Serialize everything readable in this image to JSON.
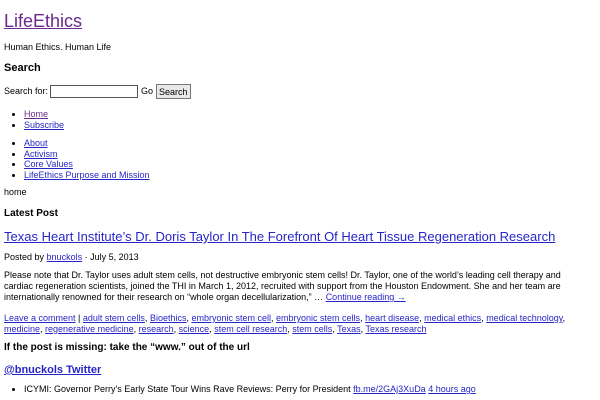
{
  "site": {
    "title": "LifeEthics",
    "tagline": "Human Ethics. Human Life"
  },
  "search": {
    "heading": "Search",
    "label": "Search for:",
    "value": "",
    "placeholder": "",
    "go": "Go",
    "button": "Search"
  },
  "menu_primary": [
    "Home",
    "Subscribe"
  ],
  "menu_secondary": [
    "About",
    "Activism",
    "Core Values",
    "LifeEthics Purpose and Mission"
  ],
  "breadcrumb": "home",
  "latest": {
    "heading": "Latest Post",
    "title": "Texas Heart Institute’s Dr. Doris Taylor In The Forefront Of Heart Tissue Regeneration Research",
    "posted_by": "Posted by",
    "author": "bnuckols",
    "separator": "·",
    "date": "July 5, 2013",
    "excerpt": "Please note that Dr. Taylor uses adult stem cells, not destructive embryonic stem cells! Dr. Taylor, one of the world’s leading cell therapy and cardiac regeneration scientists, joined the THI in March 1, 2012, recruited with support from the Houston Endowment. She and her team are internationally renowned for their research on “whole organ decellularization,” …",
    "continue": "Continue reading →",
    "leave_comment": "Leave a comment",
    "tags": [
      "adult stem cells",
      "Bioethics",
      "embryonic stem cell",
      "embryonic stem cells",
      "heart disease",
      "medical ethics",
      "medical technology",
      "medicine",
      "regenerative medicine",
      "research",
      "science",
      "stem cell research",
      "stem cells",
      "Texas",
      "Texas research"
    ]
  },
  "missing_note": "If the post is missing: take the “www.” out of the url",
  "twitter": {
    "heading": "@bnuckols Twitter",
    "tweets": [
      {
        "text": "ICYMI: Governor Perry's Early State Tour Wins Rave Reviews: Perry for President ",
        "link": "fb.me/2GAj3XuDa",
        "time": "4 hours ago"
      }
    ]
  },
  "colors": {
    "link": "#2626c8",
    "visited": "#6b2a8c"
  }
}
